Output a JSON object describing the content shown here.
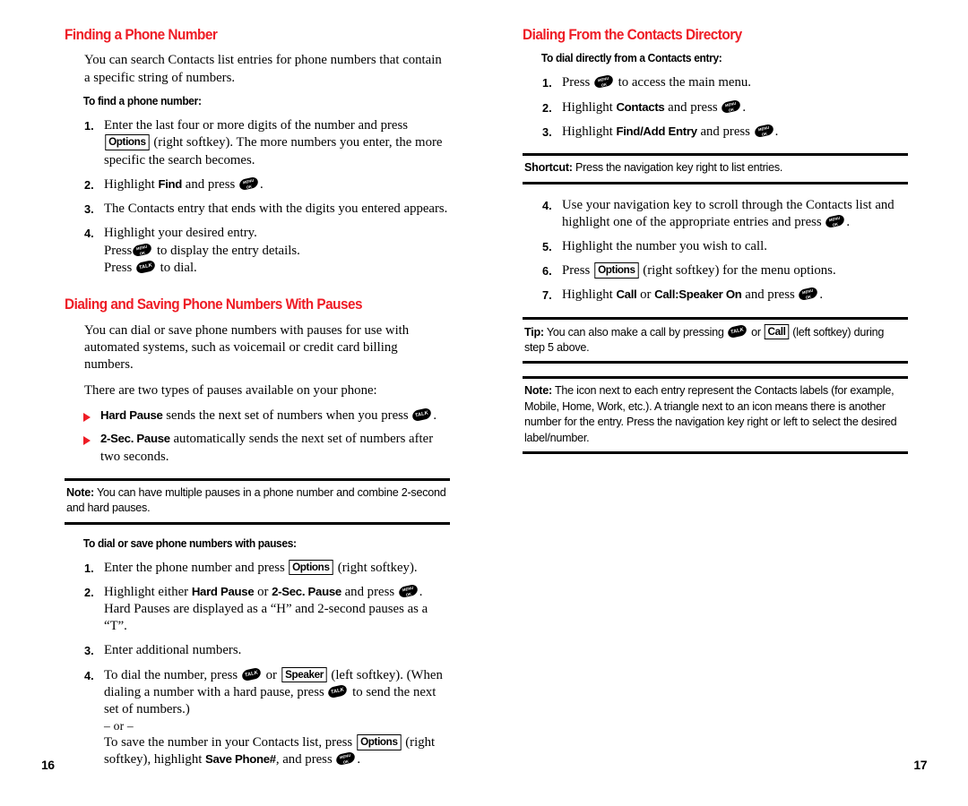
{
  "document": {
    "type": "phone-user-guide-spread",
    "accent_color": "#ee1c25",
    "text_color": "#000000",
    "background": "#ffffff"
  },
  "icons": {
    "menu_key": "menu-ok-key-icon",
    "talk_key": "talk-key-icon",
    "menu_key_label_line1": "MENU",
    "menu_key_label_line2": "OK",
    "talk_key_label": "TALK",
    "bullet": "red-triangle-bullet-icon"
  },
  "left_page": {
    "folio": "16",
    "sections": [
      {
        "title": "Finding a Phone Number",
        "lead": "You can search Contacts list entries for phone numbers that contain a specific string of numbers.",
        "subhead": "To find a phone number:",
        "steps": [
          {
            "num": "1.",
            "parts": [
              {
                "t": "text",
                "v": "Enter the last four or more digits of the number and press "
              },
              {
                "t": "softkey",
                "v": "Options"
              },
              {
                "t": "text",
                "v": " (right softkey). The more numbers you enter, the more specific the search becomes."
              }
            ]
          },
          {
            "num": "2.",
            "parts": [
              {
                "t": "text",
                "v": "Highlight "
              },
              {
                "t": "bold",
                "v": "Find"
              },
              {
                "t": "text",
                "v": " and press "
              },
              {
                "t": "key",
                "v": "menu"
              },
              {
                "t": "text",
                "v": "."
              }
            ]
          },
          {
            "num": "3.",
            "parts": [
              {
                "t": "text",
                "v": "The Contacts entry that ends with the digits you entered appears."
              }
            ]
          },
          {
            "num": "4.",
            "parts": [
              {
                "t": "text",
                "v": "Highlight your desired entry."
              },
              {
                "t": "break"
              },
              {
                "t": "text",
                "v": "Press"
              },
              {
                "t": "key",
                "v": "menu"
              },
              {
                "t": "text",
                "v": " to display the entry details."
              },
              {
                "t": "break"
              },
              {
                "t": "text",
                "v": "Press "
              },
              {
                "t": "key",
                "v": "talk"
              },
              {
                "t": "text",
                "v": " to dial."
              }
            ]
          }
        ]
      },
      {
        "title": "Dialing and Saving Phone Numbers With Pauses",
        "lead": "You can dial or save phone numbers with pauses for use with automated systems, such as voicemail or credit card billing numbers.",
        "lead2": "There are two types of pauses available on your phone:",
        "bullets": [
          {
            "parts": [
              {
                "t": "bold",
                "v": "Hard Pause"
              },
              {
                "t": "text",
                "v": " sends the next set of numbers when you press "
              },
              {
                "t": "key",
                "v": "talk"
              },
              {
                "t": "text",
                "v": "."
              }
            ]
          },
          {
            "parts": [
              {
                "t": "bold",
                "v": "2-Sec. Pause"
              },
              {
                "t": "text",
                "v": " automatically sends the next set of numbers after two seconds."
              }
            ]
          }
        ],
        "note": {
          "label": "Note:",
          "text": " You can have multiple pauses in a phone number and combine 2-second and hard pauses."
        },
        "subhead": "To dial or save phone numbers with pauses:",
        "steps2": [
          {
            "num": "1.",
            "parts": [
              {
                "t": "text",
                "v": "Enter the phone number and press "
              },
              {
                "t": "softkey",
                "v": "Options"
              },
              {
                "t": "text",
                "v": " (right softkey)."
              }
            ]
          },
          {
            "num": "2.",
            "parts": [
              {
                "t": "text",
                "v": "Highlight either "
              },
              {
                "t": "bold",
                "v": "Hard Pause"
              },
              {
                "t": "text",
                "v": " or "
              },
              {
                "t": "bold",
                "v": "2-Sec. Pause"
              },
              {
                "t": "text",
                "v": " and press "
              },
              {
                "t": "key",
                "v": "menu"
              },
              {
                "t": "text",
                "v": ". Hard Pauses are displayed as a “H” and 2-second pauses as a “T”."
              }
            ]
          },
          {
            "num": "3.",
            "parts": [
              {
                "t": "text",
                "v": "Enter additional numbers."
              }
            ]
          },
          {
            "num": "4.",
            "parts": [
              {
                "t": "text",
                "v": "To dial the number, press "
              },
              {
                "t": "key",
                "v": "talk"
              },
              {
                "t": "text",
                "v": " or "
              },
              {
                "t": "softkey",
                "v": "Speaker"
              },
              {
                "t": "text",
                "v": " (left softkey). (When dialing a number with a hard pause, press "
              },
              {
                "t": "key",
                "v": "talk"
              },
              {
                "t": "text",
                "v": " to send the next set of numbers.)"
              },
              {
                "t": "dash",
                "v": "– or –"
              },
              {
                "t": "text",
                "v": "To save the number in your Contacts list, press "
              },
              {
                "t": "softkey",
                "v": "Options"
              },
              {
                "t": "text",
                "v": " (right softkey), highlight "
              },
              {
                "t": "bold",
                "v": "Save Phone#"
              },
              {
                "t": "text",
                "v": ", and press "
              },
              {
                "t": "key",
                "v": "menu"
              },
              {
                "t": "text",
                "v": "."
              }
            ]
          }
        ]
      }
    ]
  },
  "right_page": {
    "folio": "17",
    "sections": [
      {
        "title": "Dialing From the Contacts Directory",
        "subhead": "To dial directly from a Contacts entry:",
        "steps": [
          {
            "num": "1.",
            "parts": [
              {
                "t": "text",
                "v": "Press "
              },
              {
                "t": "key",
                "v": "menu"
              },
              {
                "t": "text",
                "v": " to access the main menu."
              }
            ]
          },
          {
            "num": "2.",
            "parts": [
              {
                "t": "text",
                "v": "Highlight "
              },
              {
                "t": "bold",
                "v": "Contacts"
              },
              {
                "t": "text",
                "v": " and press "
              },
              {
                "t": "key",
                "v": "menu"
              },
              {
                "t": "text",
                "v": "."
              }
            ]
          },
          {
            "num": "3.",
            "parts": [
              {
                "t": "text",
                "v": "Highlight "
              },
              {
                "t": "bold",
                "v": "Find/Add Entry"
              },
              {
                "t": "text",
                "v": " and press "
              },
              {
                "t": "key",
                "v": "menu"
              },
              {
                "t": "text",
                "v": "."
              }
            ]
          }
        ],
        "shortcut": {
          "label": "Shortcut:",
          "text": " Press the navigation key right to list entries."
        },
        "steps2": [
          {
            "num": "4.",
            "parts": [
              {
                "t": "text",
                "v": "Use your navigation key to scroll through the Contacts list and highlight one of the appropriate entries and press "
              },
              {
                "t": "key",
                "v": "menu"
              },
              {
                "t": "text",
                "v": "."
              }
            ]
          },
          {
            "num": "5.",
            "parts": [
              {
                "t": "text",
                "v": "Highlight the number you wish to call."
              }
            ]
          },
          {
            "num": "6.",
            "parts": [
              {
                "t": "text",
                "v": "Press "
              },
              {
                "t": "softkey",
                "v": "Options"
              },
              {
                "t": "text",
                "v": " (right softkey) for the menu options."
              }
            ]
          },
          {
            "num": "7.",
            "parts": [
              {
                "t": "text",
                "v": "Highlight "
              },
              {
                "t": "bold",
                "v": "Call"
              },
              {
                "t": "text",
                "v": " or "
              },
              {
                "t": "bold",
                "v": "Call:Speaker On"
              },
              {
                "t": "text",
                "v": " and press "
              },
              {
                "t": "key",
                "v": "menu"
              },
              {
                "t": "text",
                "v": "."
              }
            ]
          }
        ],
        "tip": {
          "label": "Tip:",
          "parts": [
            {
              "t": "text",
              "v": " You can also make a call by pressing "
            },
            {
              "t": "key",
              "v": "talk"
            },
            {
              "t": "text",
              "v": " or "
            },
            {
              "t": "softkey",
              "v": "Call"
            },
            {
              "t": "text",
              "v": " (left softkey) during step 5 above."
            }
          ]
        },
        "note": {
          "label": "Note:",
          "text": " The icon next to each entry represent the Contacts labels (for example, Mobile, Home, Work, etc.). A triangle next to an icon means there is another number for the entry. Press the navigation key right or left to select the desired label/number."
        }
      }
    ]
  }
}
